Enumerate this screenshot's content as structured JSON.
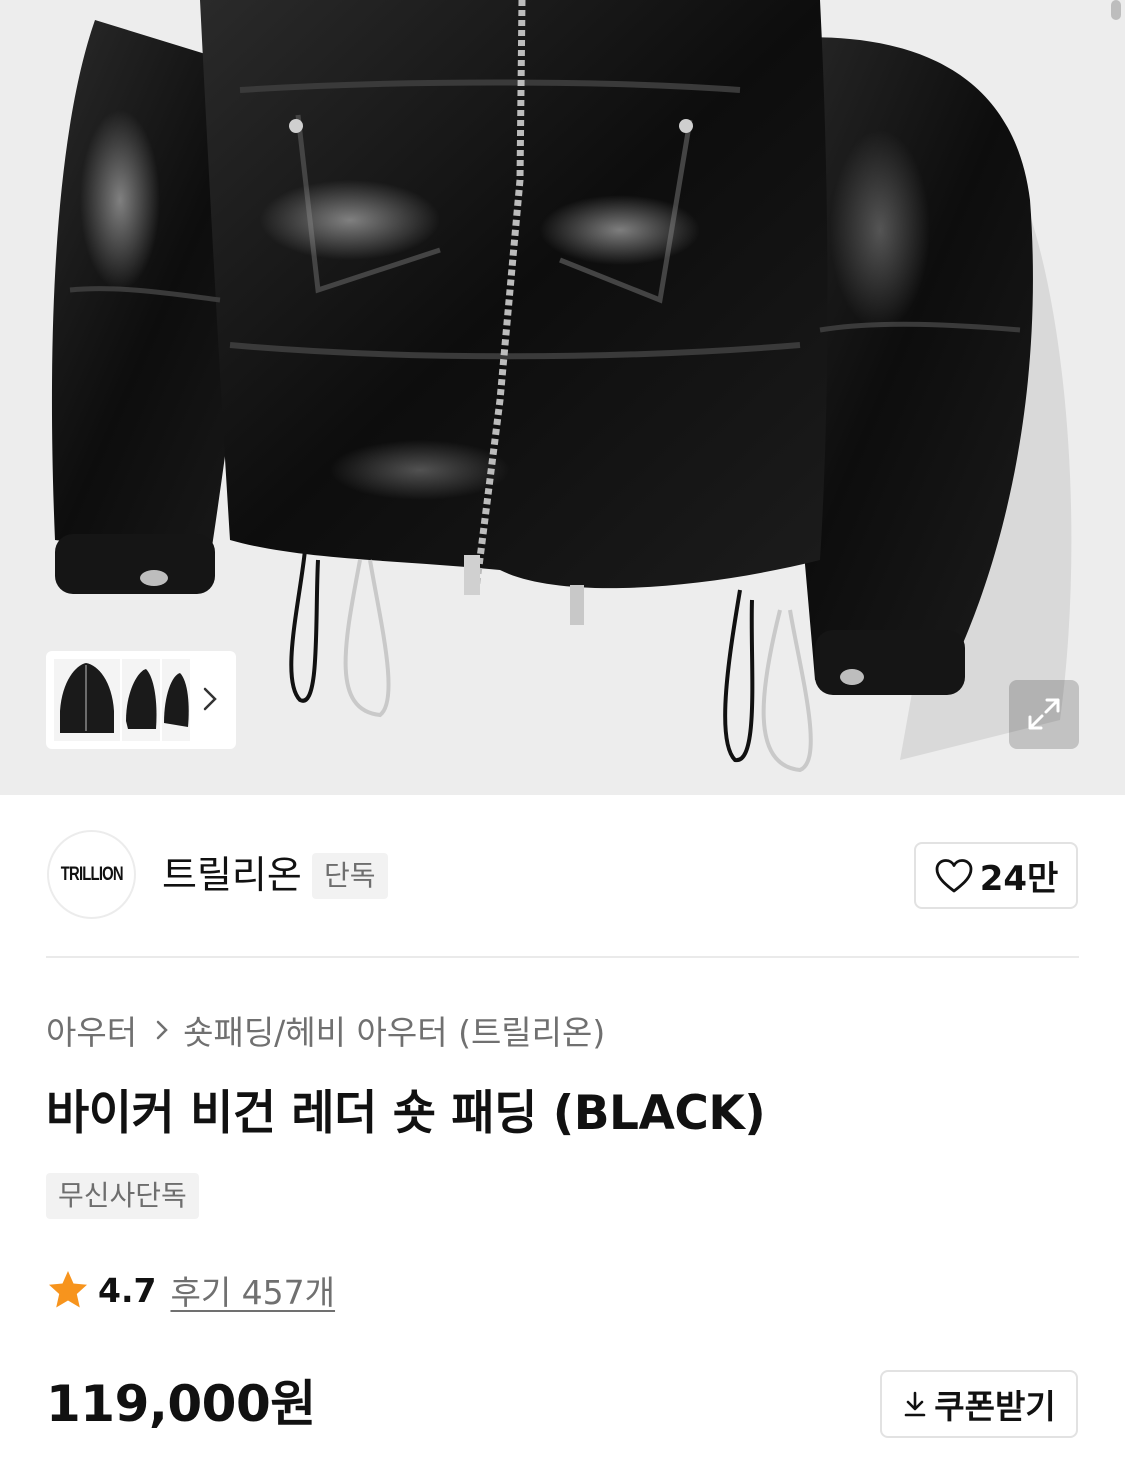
{
  "brand": {
    "logo_text": "TRILLION",
    "name": "트릴리온",
    "badge": "단독"
  },
  "like": {
    "count": "24만",
    "icon": "heart-outline-icon"
  },
  "breadcrumb": {
    "category": "아우터",
    "subcategory": "숏패딩/헤비 아우터 (트릴리온)"
  },
  "product": {
    "title": "바이커 비건 레더 숏 패딩 (BLACK)",
    "tag": "무신사단독"
  },
  "rating": {
    "score": "4.7",
    "reviews": "후기 457개",
    "star_color": "#f7941d"
  },
  "price": {
    "amount": "119,000원"
  },
  "coupon": {
    "label": "쿠폰받기",
    "icon": "download-icon"
  },
  "icons": {
    "thumbnail_next": "chevron-right-icon",
    "expand": "expand-icon"
  }
}
